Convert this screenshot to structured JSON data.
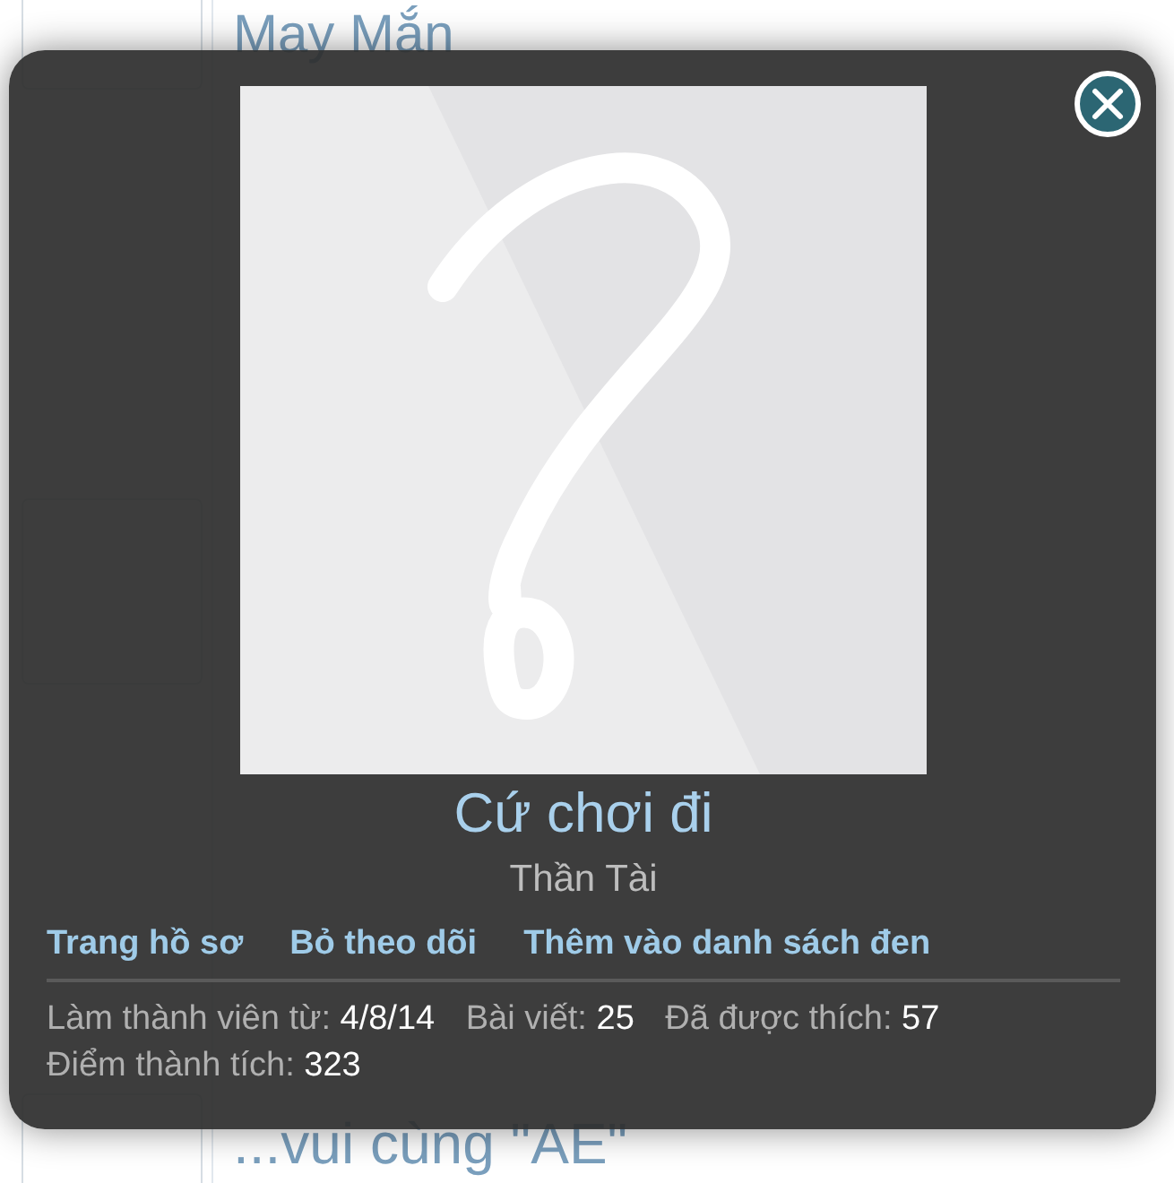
{
  "background": {
    "titles": [
      "May Mắn",
      "...vui cùng \"AE\""
    ]
  },
  "member_card": {
    "username": "Cứ chơi đi",
    "user_title": "Thần Tài",
    "links": [
      "Trang hồ sơ",
      "Bỏ theo dõi",
      "Thêm vào danh sách đen"
    ],
    "stats": [
      {
        "label": "Làm thành viên từ:",
        "value": "4/8/14"
      },
      {
        "label": "Bài viết:",
        "value": "25"
      },
      {
        "label": "Đã được thích:",
        "value": "57"
      },
      {
        "label": "Điểm thành tích:",
        "value": "323"
      }
    ]
  }
}
